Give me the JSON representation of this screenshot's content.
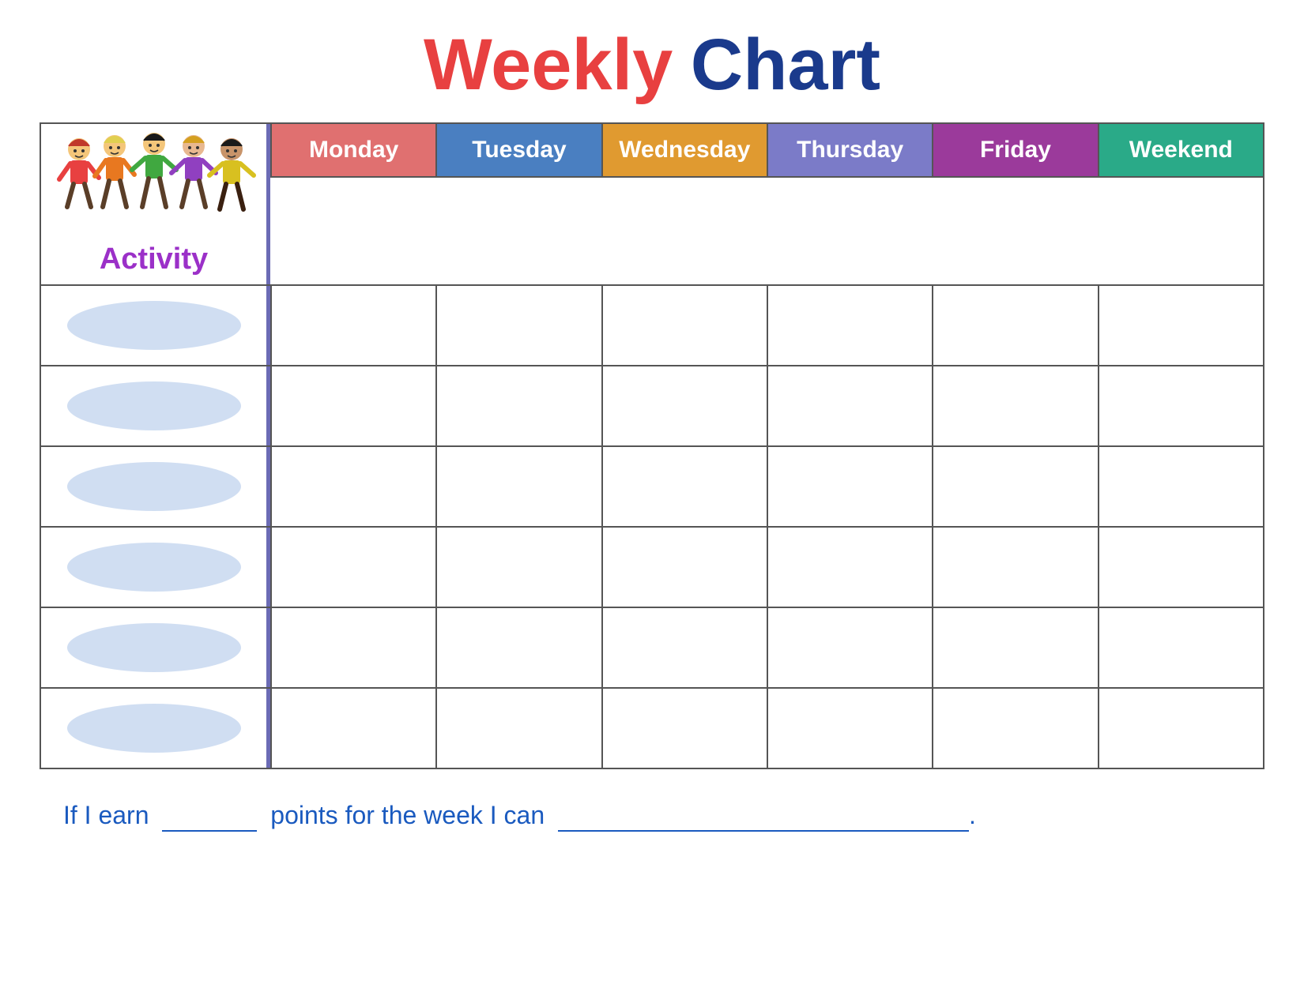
{
  "title": {
    "weekly": "Weekly",
    "chart": "Chart"
  },
  "header": {
    "activity_label": "Activity",
    "days": [
      {
        "label": "Monday",
        "class": "monday-bg"
      },
      {
        "label": "Tuesday",
        "class": "tuesday-bg"
      },
      {
        "label": "Wednesday",
        "class": "wednesday-bg"
      },
      {
        "label": "Thursday",
        "class": "thursday-bg"
      },
      {
        "label": "Friday",
        "class": "friday-bg"
      },
      {
        "label": "Weekend",
        "class": "weekend-bg"
      }
    ]
  },
  "rows": [
    {
      "id": 1
    },
    {
      "id": 2
    },
    {
      "id": 3
    },
    {
      "id": 4
    },
    {
      "id": 5
    },
    {
      "id": 6
    }
  ],
  "footer": {
    "text_start": "If I earn",
    "blank_points": "_____",
    "text_middle": "points for the week I can",
    "blank_reward": ""
  }
}
